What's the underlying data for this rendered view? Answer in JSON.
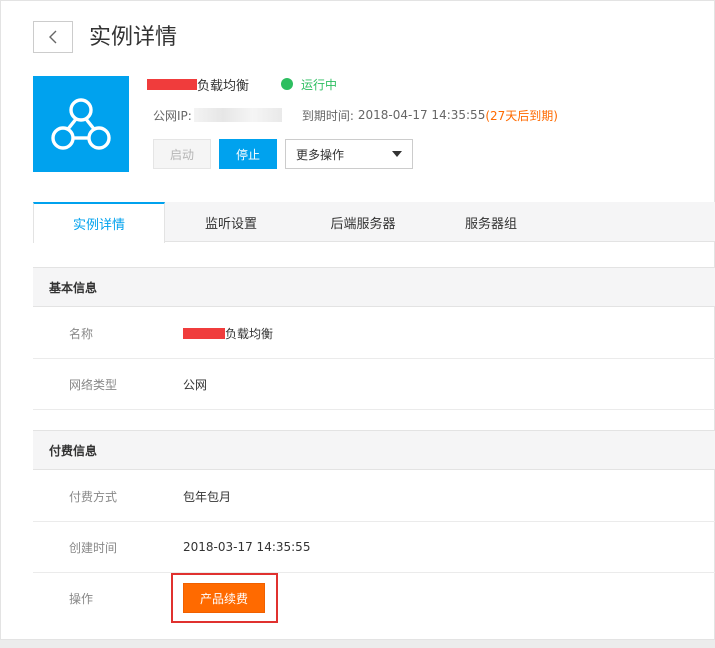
{
  "header": {
    "title": "实例详情"
  },
  "instance": {
    "name_suffix": "负载均衡",
    "status": "运行中",
    "colors": {
      "status": "#2dbe60",
      "accent": "#00a2ee",
      "warn": "#ff6a00"
    },
    "ip_label": "公网IP:",
    "expire_label": "到期时间:",
    "expire_time": "2018-04-17 14:35:55",
    "expire_note": "(27天后到期)"
  },
  "actions": {
    "start": "启动",
    "stop": "停止",
    "more": "更多操作"
  },
  "tabs": [
    {
      "label": "实例详情"
    },
    {
      "label": "监听设置"
    },
    {
      "label": "后端服务器"
    },
    {
      "label": "服务器组"
    }
  ],
  "basic": {
    "title": "基本信息",
    "name_label": "名称",
    "name_value": "负载均衡",
    "net_label": "网络类型",
    "net_value": "公网"
  },
  "billing": {
    "title": "付费信息",
    "method_label": "付费方式",
    "method_value": "包年包月",
    "created_label": "创建时间",
    "created_value": "2018-03-17 14:35:55",
    "op_label": "操作",
    "renew_button": "产品续费"
  },
  "icons": [
    "chevron-left-icon",
    "network-node-icon",
    "caret-down-icon"
  ]
}
